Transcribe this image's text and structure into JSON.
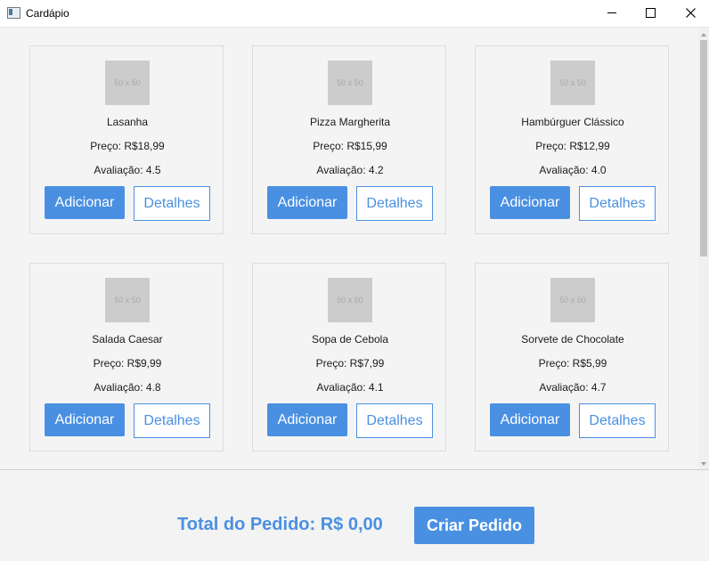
{
  "window": {
    "title": "Cardápio"
  },
  "menu": {
    "add_label": "Adicionar",
    "details_label": "Detalhes",
    "thumb_text": "50 x 50",
    "items": [
      {
        "name": "Lasanha",
        "price": "Preço: R$18,99",
        "rating": "Avaliação: 4.5"
      },
      {
        "name": "Pizza Margherita",
        "price": "Preço: R$15,99",
        "rating": "Avaliação: 4.2"
      },
      {
        "name": "Hambúrguer Clássico",
        "price": "Preço: R$12,99",
        "rating": "Avaliação: 4.0"
      },
      {
        "name": "Salada Caesar",
        "price": "Preço: R$9,99",
        "rating": "Avaliação: 4.8"
      },
      {
        "name": "Sopa de Cebola",
        "price": "Preço: R$7,99",
        "rating": "Avaliação: 4.1"
      },
      {
        "name": "Sorvete de Chocolate",
        "price": "Preço: R$5,99",
        "rating": "Avaliação: 4.7"
      }
    ]
  },
  "footer": {
    "total_text": "Total do Pedido: R$ 0,00",
    "create_label": "Criar Pedido"
  },
  "colors": {
    "accent": "#4a90e2"
  }
}
